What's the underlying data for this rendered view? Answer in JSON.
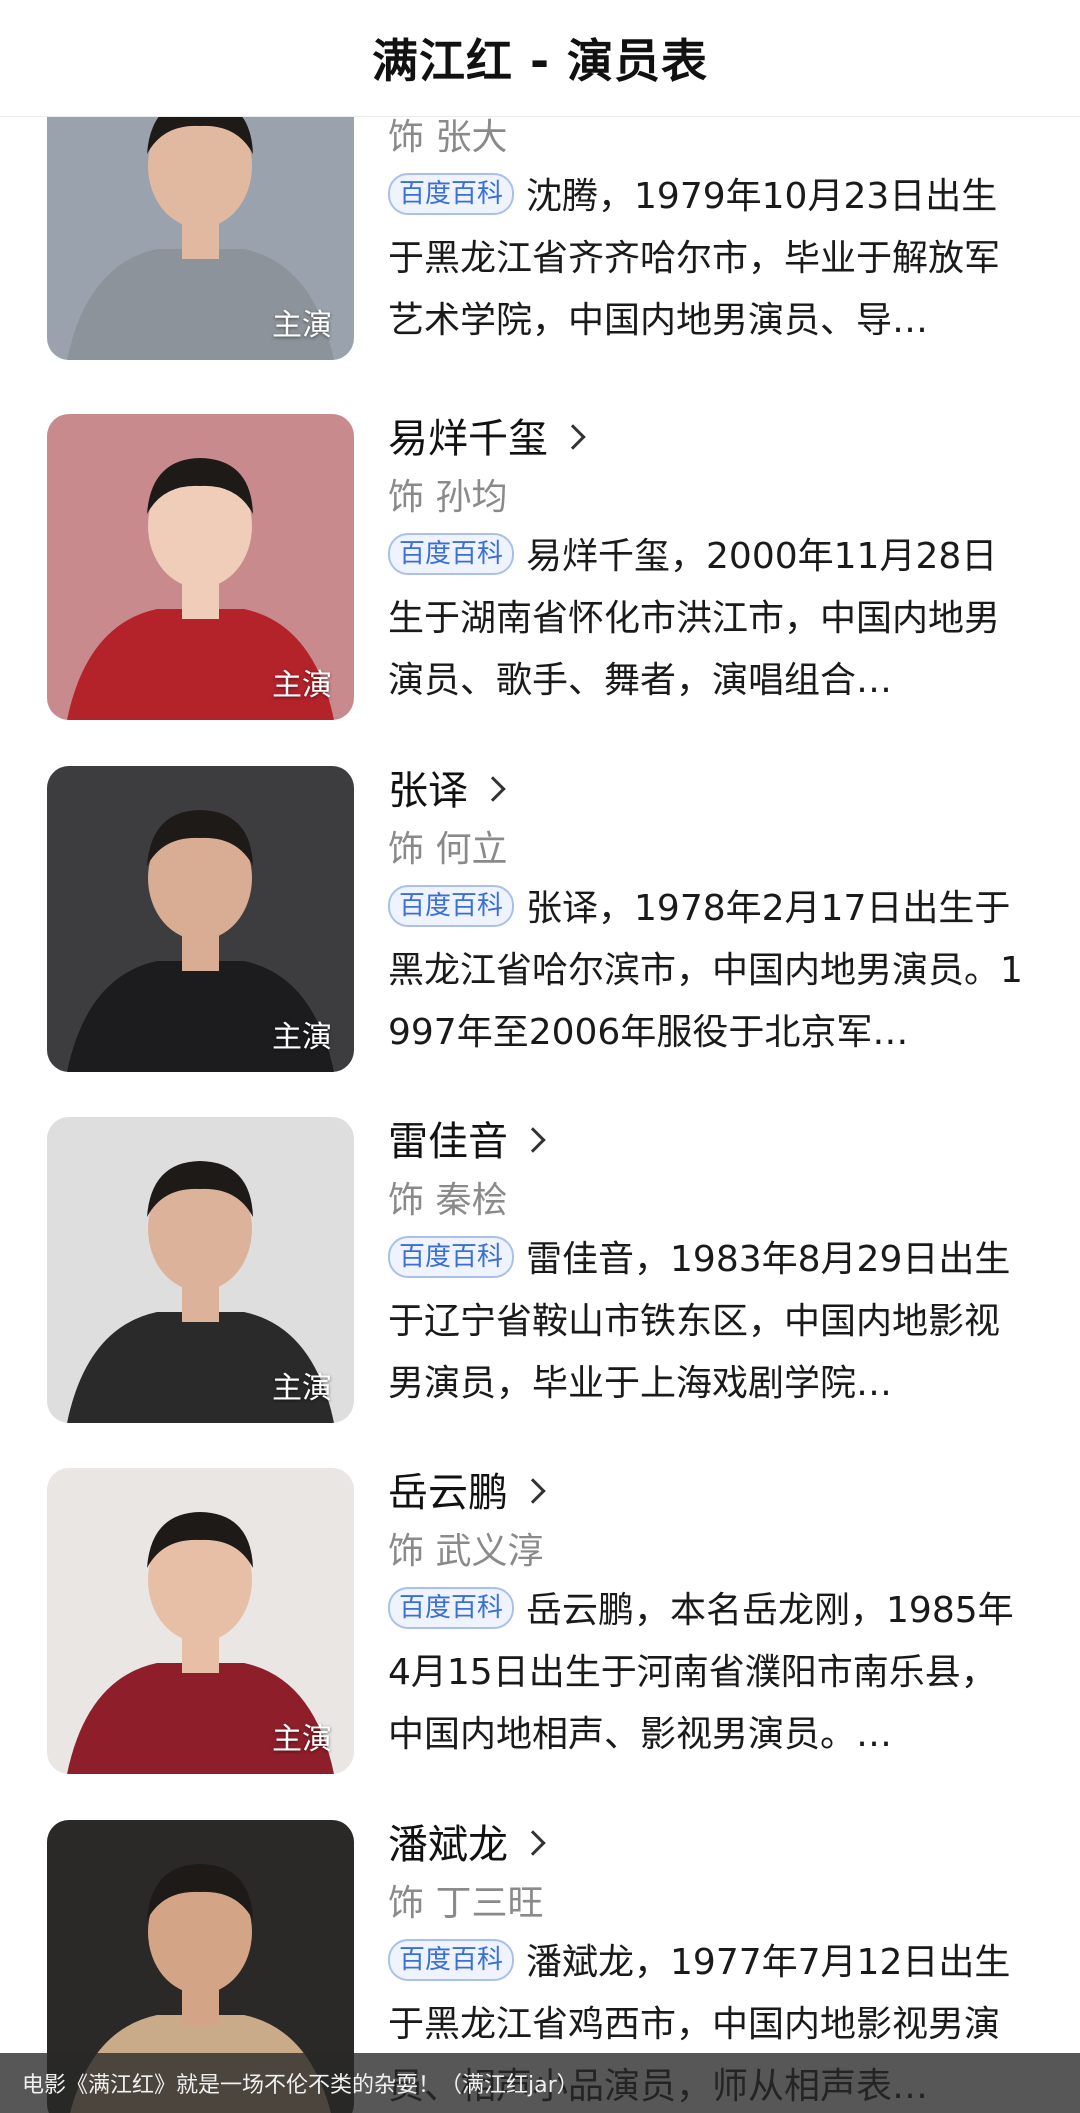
{
  "header": {
    "title": "满江红 - 演员表"
  },
  "baike_label": "百度百科",
  "lead_label": "主演",
  "cast": [
    {
      "name": "",
      "role": "饰 张大",
      "bio": "沈腾，1979年10月23日出生于黑龙江省齐齐哈尔市，毕业于解放军艺术学院，中国内地男演员、导…",
      "bg": "#9aa3ad",
      "suit": "#8c939b",
      "skin": "#e0b9a0"
    },
    {
      "name": "易烊千玺",
      "role": "饰 孙均",
      "bio": "易烊千玺，2000年11月28日生于湖南省怀化市洪江市，中国内地男演员、歌手、舞者，演唱组合…",
      "bg": "#c98a8e",
      "suit": "#b4222a",
      "skin": "#efcdb9"
    },
    {
      "name": "张译",
      "role": "饰 何立",
      "bio": "张译，1978年2月17日出生于黑龙江省哈尔滨市，中国内地男演员。1997年至2006年服役于北京军…",
      "bg": "#3d3d3f",
      "suit": "#1c1c1e",
      "skin": "#d8ad93"
    },
    {
      "name": "雷佳音",
      "role": "饰 秦桧",
      "bio": "雷佳音，1983年8月29日出生于辽宁省鞍山市铁东区，中国内地影视男演员，毕业于上海戏剧学院…",
      "bg": "#dedede",
      "suit": "#2a2a2a",
      "skin": "#dcb29a"
    },
    {
      "name": "岳云鹏",
      "role": "饰 武义淳",
      "bio": "岳云鹏，本名岳龙刚，1985年4月15日出生于河南省濮阳市南乐县，中国内地相声、影视男演员。…",
      "bg": "#e9e6e4",
      "suit": "#8e1f2a",
      "skin": "#e6bfa6"
    },
    {
      "name": "潘斌龙",
      "role": "饰 丁三旺",
      "bio": "潘斌龙，1977年7月12日出生于黑龙江省鸡西市，中国内地影视男演员、相声小品演员，师从相声表…",
      "bg": "#2b2927",
      "suit": "#c9ab8a",
      "skin": "#d4a486"
    }
  ],
  "bottom_bar": {
    "text": "电影《满江红》就是一场不伦不类的杂耍！（满江红jar）"
  }
}
